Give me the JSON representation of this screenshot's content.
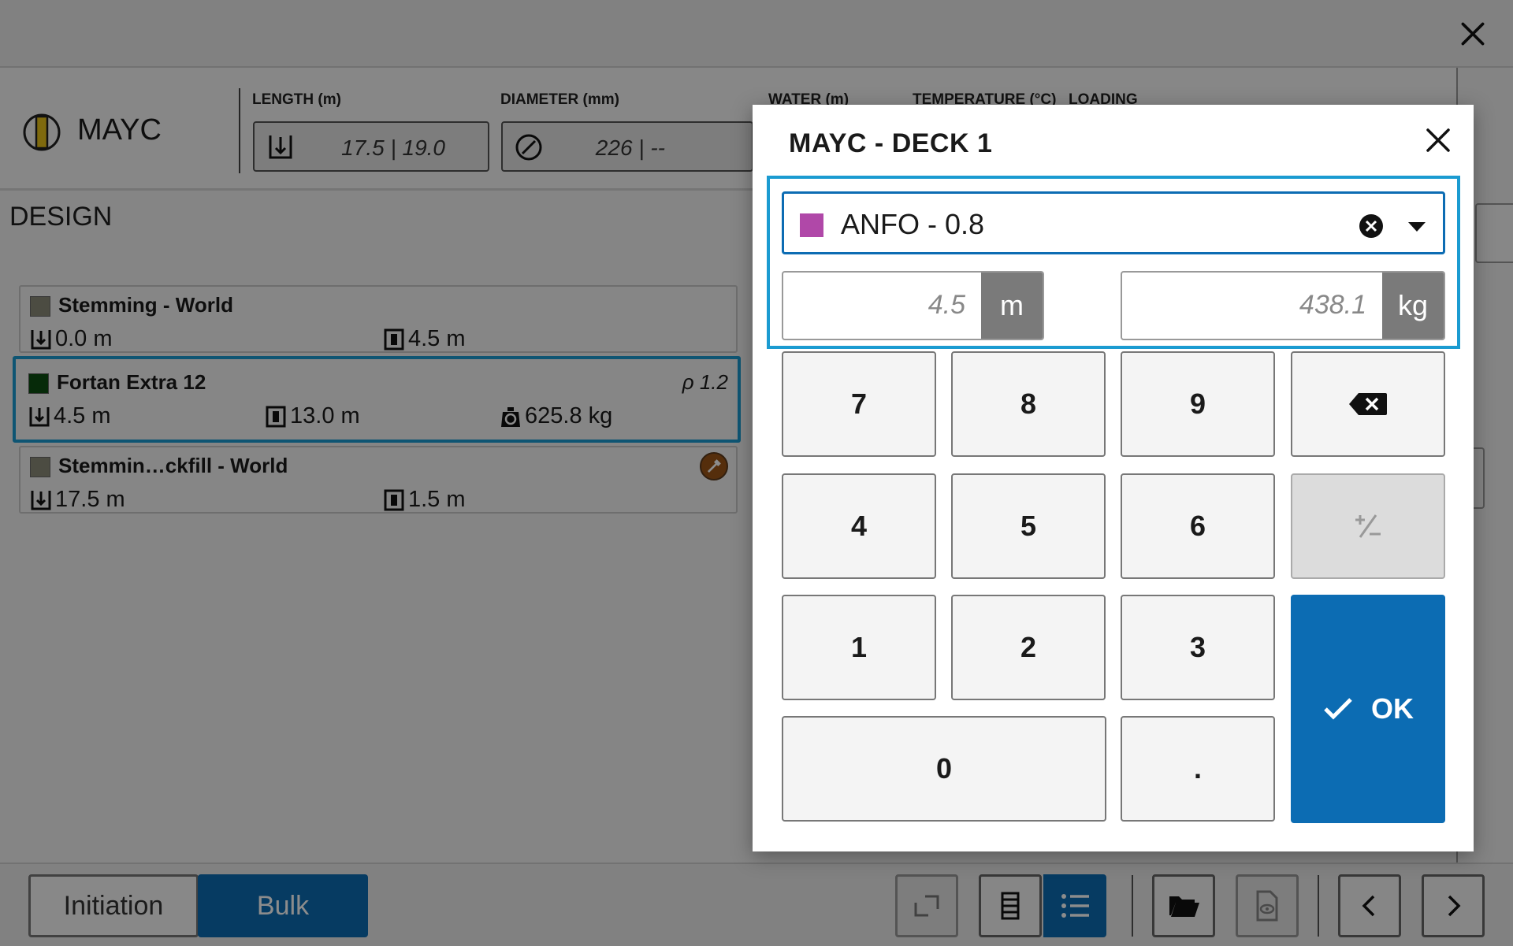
{
  "hole": {
    "name": "MAYC"
  },
  "fields": {
    "length_label": "LENGTH (m)",
    "length_value": "17.5 | 19.0",
    "diameter_label": "DIAMETER (mm)",
    "diameter_value": "226 | --",
    "water_label": "WATER (m)",
    "temperature_label": "TEMPERATURE (°C)",
    "loading_label": "LOADING"
  },
  "design": {
    "title": "DESIGN",
    "decks": [
      {
        "name": "Stemming - World",
        "color": "#8b8b78",
        "top": "0.0 m",
        "length": "4.5 m"
      },
      {
        "name": "Fortan Extra 12",
        "color": "#0b4d12",
        "top": "4.5 m",
        "length": "13.0 m",
        "mass": "625.8 kg",
        "density": "ρ 1.2"
      },
      {
        "name": "Stemmin…ckfill - World",
        "color": "#8b8b78",
        "top": "17.5 m",
        "length": "1.5 m"
      }
    ]
  },
  "bottom": {
    "initiation": "Initiation",
    "bulk": "Bulk"
  },
  "dialog": {
    "title": "MAYC - DECK 1",
    "product": {
      "name": "ANFO - 0.8",
      "color": "#b048a8"
    },
    "length": {
      "value": "4.5",
      "unit": "m"
    },
    "mass": {
      "value": "438.1",
      "unit": "kg"
    },
    "keys": {
      "k7": "7",
      "k8": "8",
      "k9": "9",
      "k4": "4",
      "k5": "5",
      "k6": "6",
      "k1": "1",
      "k2": "2",
      "k3": "3",
      "k0": "0",
      "dot": ".",
      "ok": "OK"
    }
  },
  "colors": {
    "accent": "#0c6cb3",
    "focus": "#1b9bd1"
  }
}
